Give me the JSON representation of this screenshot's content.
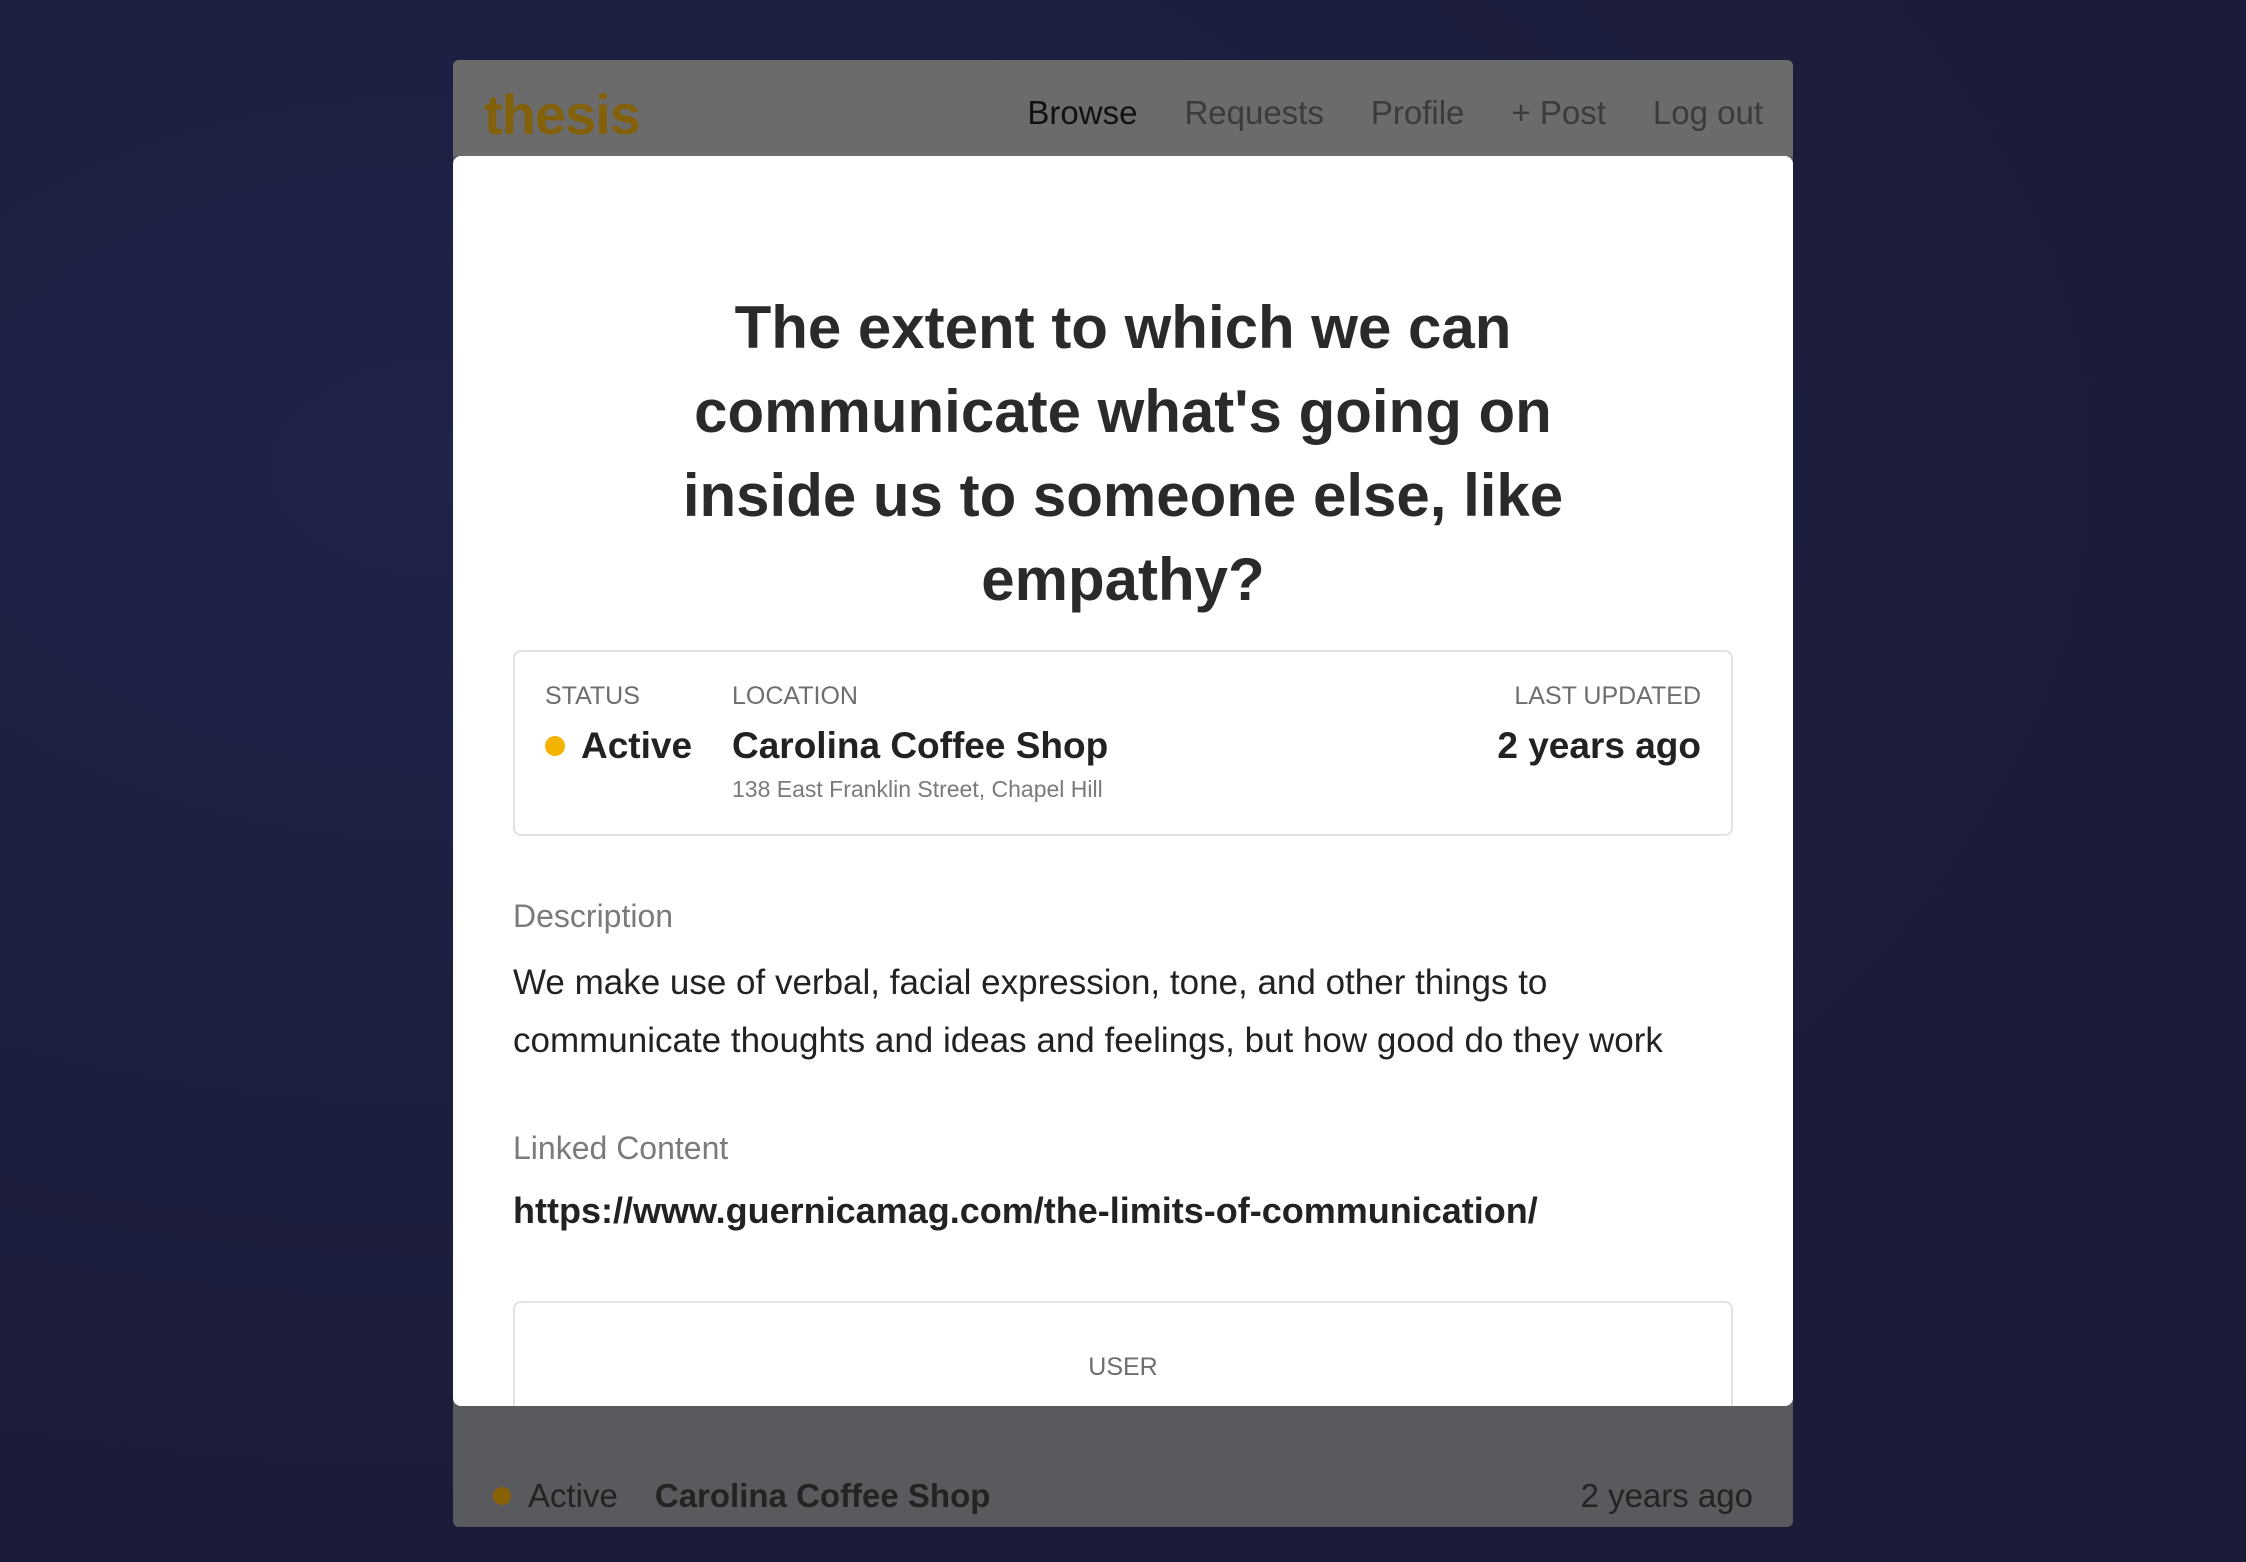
{
  "app": {
    "logo": "thesis"
  },
  "nav": {
    "browse": "Browse",
    "requests": "Requests",
    "profile": "Profile",
    "post": "+ Post",
    "logout": "Log out"
  },
  "background_row": {
    "status": "Active",
    "location": "Carolina Coffee Shop",
    "updated": "2 years ago"
  },
  "modal": {
    "title": "The extent to which we can communicate what's going on inside us to someone else, like empathy?",
    "status_label": "STATUS",
    "status_value": "Active",
    "location_label": "LOCATION",
    "location_name": "Carolina Coffee Shop",
    "location_address": "138 East Franklin Street, Chapel Hill",
    "updated_label": "LAST UPDATED",
    "updated_value": "2 years ago",
    "description_label": "Description",
    "description": "We make use of verbal, facial expression, tone, and other things to communicate thoughts and ideas and feelings, but how good do they work",
    "linked_label": "Linked Content",
    "linked_url": "https://www.guernicamag.com/the-limits-of-communication/",
    "user_label": "USER"
  },
  "colors": {
    "background": "#1b1d3b",
    "logo": "#83610b",
    "status_active": "#f5b301"
  }
}
